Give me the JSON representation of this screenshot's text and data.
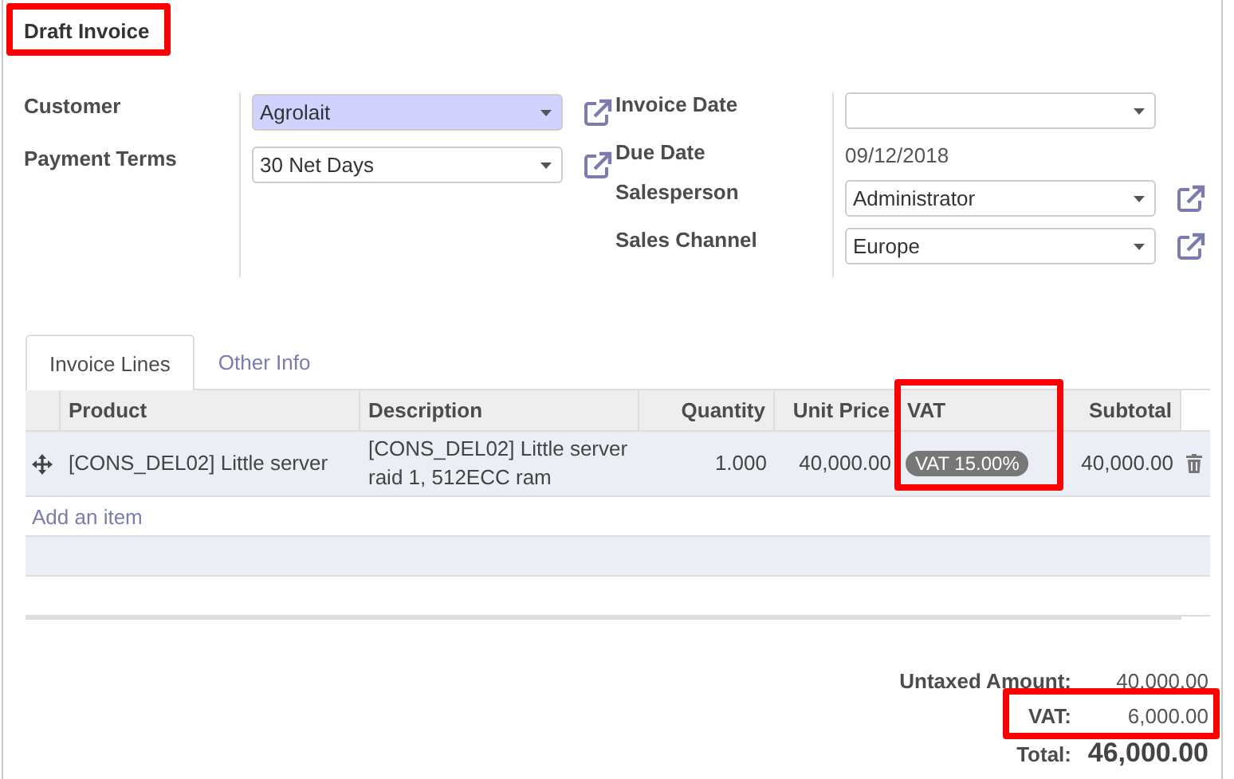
{
  "title": {
    "text": "Draft Invoice",
    "highlighted": true
  },
  "left_fields": [
    {
      "label": "Customer",
      "kind": "select",
      "value": "Agrolait",
      "required": true,
      "link": true
    },
    {
      "label": "Payment Terms",
      "kind": "select",
      "value": "30 Net Days",
      "required": false,
      "link": true
    }
  ],
  "right_fields": [
    {
      "label": "Invoice Date",
      "kind": "select",
      "required": false,
      "link": false
    },
    {
      "label": "Due Date",
      "kind": "text",
      "value": "09/12/2018",
      "link": false
    },
    {
      "label": "Salesperson",
      "kind": "select",
      "value": "Administrator",
      "required": false,
      "link": true
    },
    {
      "label": "Sales Channel",
      "kind": "select",
      "value": "Europe",
      "required": false,
      "link": true
    }
  ],
  "tabs": [
    {
      "label": "Invoice Lines",
      "selected": true
    },
    {
      "label": "Other Info",
      "selected": false
    }
  ],
  "table": {
    "columns": [
      {
        "label": "Product",
        "kind": "text",
        "highlighted": false
      },
      {
        "label": "Description",
        "kind": "text",
        "highlighted": false
      },
      {
        "label": "Quantity",
        "kind": "number",
        "highlighted": false
      },
      {
        "label": "Unit Price",
        "kind": "number",
        "highlighted": false
      },
      {
        "label": "VAT",
        "kind": "tag",
        "highlighted": true
      },
      {
        "label": "Subtotal",
        "kind": "number",
        "highlighted": false
      }
    ],
    "rows": [
      {
        "cells": [
          "[CONS_DEL02] Little server",
          "[CONS_DEL02] Little server\nraid 1, 512ECC ram",
          "1.000",
          "40,000.00",
          "VAT 15.00%",
          "40,000.00"
        ]
      }
    ],
    "add_link": "Add an item"
  },
  "totals": [
    {
      "label": "Untaxed Amount:",
      "value": "40,000.00",
      "kind": "normal",
      "highlighted": false
    },
    {
      "label": "VAT:",
      "value": "6,000.00",
      "kind": "normal",
      "highlighted": true
    },
    {
      "label": "Total:",
      "value": "46,000.00",
      "kind": "grand",
      "highlighted": false
    }
  ]
}
